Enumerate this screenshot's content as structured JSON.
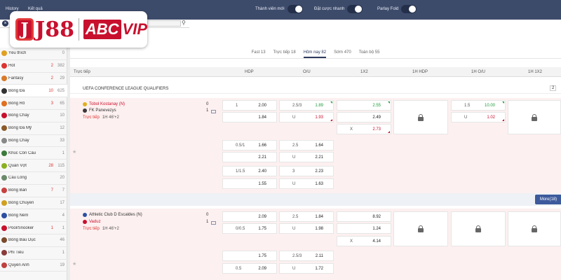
{
  "topbar": {
    "history": "History",
    "results": "Kết quả",
    "toggles": [
      {
        "label": "Thành viên mới"
      },
      {
        "label": "Đặt cược nhanh"
      },
      {
        "label": "Parlay Fold"
      }
    ]
  },
  "logo": {
    "brand1": "J88",
    "brand2": "ABC",
    "brand3": "VIP"
  },
  "sidebar": {
    "items": [
      {
        "name": "Yêu thích",
        "live": "",
        "count": "0"
      },
      {
        "name": "Hot",
        "live": "2",
        "count": "382"
      },
      {
        "name": "Fantasy",
        "live": "2",
        "count": "29"
      },
      {
        "name": "Bóng Đá",
        "live": "10",
        "count": "625"
      },
      {
        "name": "Bóng Rổ",
        "live": "3",
        "count": "65"
      },
      {
        "name": "Bóng Chày",
        "live": "",
        "count": "10"
      },
      {
        "name": "Bóng Đá Mỹ",
        "live": "",
        "count": "12"
      },
      {
        "name": "Bóng Chày",
        "live": "",
        "count": "33"
      },
      {
        "name": "Khúc Côn Cầu",
        "live": "",
        "count": "1"
      },
      {
        "name": "Quần Vợt",
        "live": "28",
        "count": "115"
      },
      {
        "name": "Cầu Lông",
        "live": "",
        "count": "20"
      },
      {
        "name": "Bóng Bàn",
        "live": "7",
        "count": "7"
      },
      {
        "name": "Bóng Chuyền",
        "live": "",
        "count": "17"
      },
      {
        "name": "Bóng Ném",
        "live": "",
        "count": "4"
      },
      {
        "name": "Pool/Snooker",
        "live": "1",
        "count": "1"
      },
      {
        "name": "Bóng Bầu Dục",
        "live": "",
        "count": "46"
      },
      {
        "name": "Phi Tiêu",
        "live": "",
        "count": "1"
      },
      {
        "name": "Quyền Anh",
        "live": "",
        "count": "19"
      }
    ]
  },
  "tabs": [
    {
      "label": "Fast 13"
    },
    {
      "label": "Trực tiếp 18"
    },
    {
      "label": "Hôm nay 82"
    },
    {
      "label": "Sớm 470"
    },
    {
      "label": "Toàn bộ 55"
    }
  ],
  "columns": {
    "live": "Trực tiếp",
    "hdp": "HDP",
    "ou": "O/U",
    "x12": "1X2",
    "h1hdp": "1H HDP",
    "h1ou": "1H O/U",
    "h1x12": "1H 1X2"
  },
  "league": {
    "name": "UEFA CONFERENCE LEAGUE QUALIFIERS",
    "page": "2"
  },
  "matches": [
    {
      "home": "Tobol Kostanay (N)",
      "away": "FK Panevezys",
      "home_score": "0",
      "away_score": "1",
      "status": "Trực tiếp",
      "time": "1H 46'+2",
      "rows": [
        {
          "hdp_l": "1",
          "hdp_r": "2.00",
          "ou_l": "2.5/3",
          "ou_r": "1.89",
          "x_l": "",
          "x_r": "2.55"
        },
        {
          "hdp_l": "",
          "hdp_r": "1.84",
          "ou_l": "U",
          "ou_r": "1.93",
          "x_l": "",
          "x_r": "2.49"
        },
        {
          "hdp_l": "",
          "hdp_r": "",
          "ou_l": "",
          "ou_r": "",
          "x_l": "X",
          "x_r": "2.73"
        }
      ],
      "alt": [
        {
          "hdp_l": "0.5/1",
          "hdp_r": "1.66",
          "ou_l": "2.5",
          "ou_r": "1.64"
        },
        {
          "hdp_l": "",
          "hdp_r": "2.21",
          "ou_l": "U",
          "ou_r": "2.21"
        },
        {
          "hdp_l": "1/1.5",
          "hdp_r": "2.40",
          "ou_l": "3",
          "ou_r": "2.23"
        },
        {
          "hdp_l": "",
          "hdp_r": "1.55",
          "ou_l": "U",
          "ou_r": "1.63"
        }
      ],
      "h1ou": [
        {
          "l": "1.5",
          "r": "10.00"
        },
        {
          "l": "U",
          "r": "1.02"
        }
      ],
      "more": "More(18)"
    },
    {
      "home": "Athletic Club D Escaldes (N)",
      "away": "Vaduz",
      "home_score": "0",
      "away_score": "1",
      "status": "Trực tiếp",
      "time": "1H 46'+2",
      "rows": [
        {
          "hdp_l": "",
          "hdp_r": "2.09",
          "ou_l": "2.5",
          "ou_r": "1.84",
          "x_l": "",
          "x_r": "8.92"
        },
        {
          "hdp_l": "0/0.5",
          "hdp_r": "1.75",
          "ou_l": "U",
          "ou_r": "1.98",
          "x_l": "",
          "x_r": "1.24"
        },
        {
          "hdp_l": "",
          "hdp_r": "",
          "ou_l": "",
          "ou_r": "",
          "x_l": "X",
          "x_r": "4.14"
        }
      ],
      "alt": [
        {
          "hdp_l": "",
          "hdp_r": "1.75",
          "ou_l": "2.5/3",
          "ou_r": "2.11"
        },
        {
          "hdp_l": "0.5",
          "hdp_r": "2.09",
          "ou_l": "U",
          "ou_r": "1.72"
        }
      ]
    }
  ],
  "colors": {
    "topbar": "#3d4b6b",
    "brand_red": "#c8102e",
    "up_green": "#1d9b3a",
    "live_red": "#d33",
    "more_blue": "#3d5a9c"
  }
}
